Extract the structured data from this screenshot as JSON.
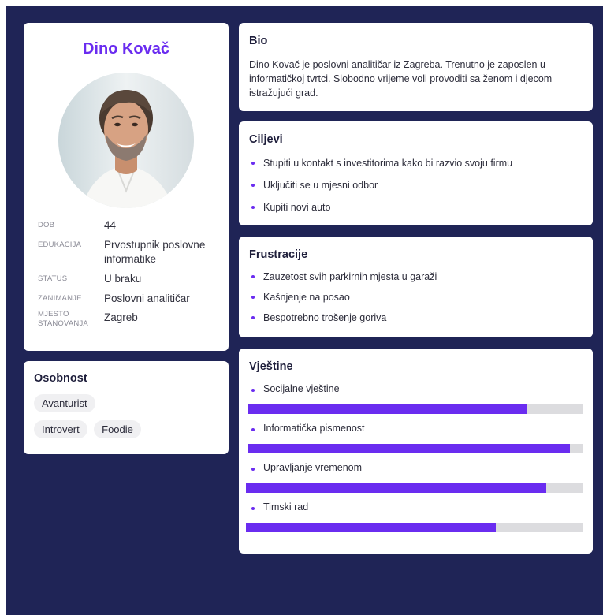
{
  "profile": {
    "name": "Dino Kovač",
    "facts": [
      {
        "label": "DOB",
        "value": "44"
      },
      {
        "label": "EDUKACIJA",
        "value": "Prvostupnik poslovne informatike"
      },
      {
        "label": "STATUS",
        "value": "U braku"
      },
      {
        "label": "ZANIMANJE",
        "value": "Poslovni analitičar"
      },
      {
        "label": "MJESTO STANOVANJA",
        "value": "Zagreb"
      }
    ]
  },
  "personality": {
    "title": "Osobnost",
    "tags": [
      "Avanturist",
      "Introvert",
      "Foodie"
    ]
  },
  "bio": {
    "title": "Bio",
    "text": "Dino Kovač je poslovni analitičar iz Zagreba. Trenutno je zaposlen u informatičkoj tvrtci. Slobodno vrijeme voli provoditi sa ženom i djecom istražujući grad."
  },
  "goals": {
    "title": "Ciljevi",
    "items": [
      "Stupiti u kontakt s investitorima kako bi razvio svoju firmu",
      "Uključiti se u mjesni odbor",
      "Kupiti novi auto"
    ]
  },
  "frustrations": {
    "title": "Frustracije",
    "items": [
      "Zauzetost svih parkirnih mjesta u garaži",
      "Kašnjenje na posao",
      "Bespotrebno trošenje goriva"
    ]
  },
  "skills": {
    "title": "Vještine",
    "items": [
      {
        "name": "Socijalne vještine",
        "level": 0.83
      },
      {
        "name": "Informatička pismenost",
        "level": 0.96
      },
      {
        "name": "Upravljanje vremenom",
        "level": 0.89
      },
      {
        "name": "Timski rad",
        "level": 0.74
      }
    ]
  },
  "colors": {
    "accent": "#6a2cf0",
    "background": "#1f2456",
    "track": "#dcdcdf"
  }
}
